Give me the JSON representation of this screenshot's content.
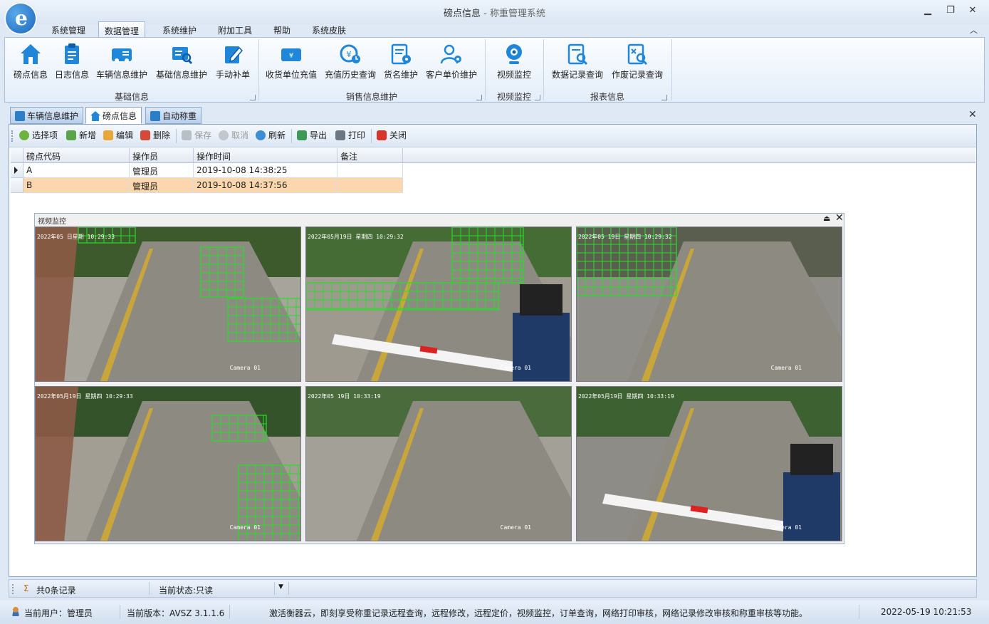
{
  "window": {
    "title": "磅点信息",
    "title_suffix": " - 称重管理系统"
  },
  "menu": [
    "系统管理",
    "数据管理",
    "系统维护",
    "附加工具",
    "帮助",
    "系统皮肤"
  ],
  "menu_active": 1,
  "ribbon": {
    "groups": [
      {
        "label": "基础信息",
        "buttons": [
          "磅点信息",
          "日志信息",
          "车辆信息维护",
          "基础信息维护",
          "手动补单"
        ]
      },
      {
        "label": "销售信息维护",
        "buttons": [
          "收货单位充值",
          "充值历史查询",
          "货名维护",
          "客户单价维护"
        ]
      },
      {
        "label": "视频监控",
        "buttons": [
          "视频监控"
        ]
      },
      {
        "label": "报表信息",
        "buttons": [
          "数据记录查询",
          "作废记录查询"
        ]
      }
    ]
  },
  "doc_tabs": [
    "车辆信息维护",
    "磅点信息",
    "自动称重"
  ],
  "doc_tab_active": 1,
  "toolbar": {
    "select": "选择项",
    "add": "新增",
    "edit": "编辑",
    "delete": "删除",
    "save": "保存",
    "cancel": "取消",
    "refresh": "刷新",
    "export": "导出",
    "print": "打印",
    "close": "关闭"
  },
  "grid": {
    "columns": [
      "磅点代码",
      "操作员",
      "操作时间",
      "备注"
    ],
    "rows": [
      [
        "A",
        "管理员",
        "2019-10-08 14:38:25",
        ""
      ],
      [
        "B",
        "管理员",
        "2019-10-08 14:37:56",
        ""
      ]
    ],
    "selected_row": 1
  },
  "video": {
    "title": "视频监控",
    "cameras": [
      {
        "timestamp": "2022年05  日星期  10:29:33",
        "name": "Camera 01"
      },
      {
        "timestamp": "2022年05月19日 星期四 10:29:32",
        "name": "Camera 01"
      },
      {
        "timestamp": "2022年05 19日 星期四 10:29:32",
        "name": "Camera 01"
      },
      {
        "timestamp": "2022年05月19日 星期四 10:29:33",
        "name": "Camera 01"
      },
      {
        "timestamp": "2022年05  19日  10:33:19",
        "name": "Camera 01"
      },
      {
        "timestamp": "2022年05月19日 星期四 10:33:19",
        "name": "Camera 01"
      }
    ]
  },
  "status1": {
    "records": "共0条记录",
    "state": "当前状态:只读"
  },
  "status2": {
    "user": "当前用户：管理员",
    "version": "当前版本：AVSZ 3.1.1.6",
    "notice": "激活衡器云，即刻享受称重记录远程查询，远程修改，远程定价，视频监控，订单查询，网络打印审核，网络记录修改审核和称重审核等功能。",
    "datetime": "2022-05-19 10:21:53"
  }
}
